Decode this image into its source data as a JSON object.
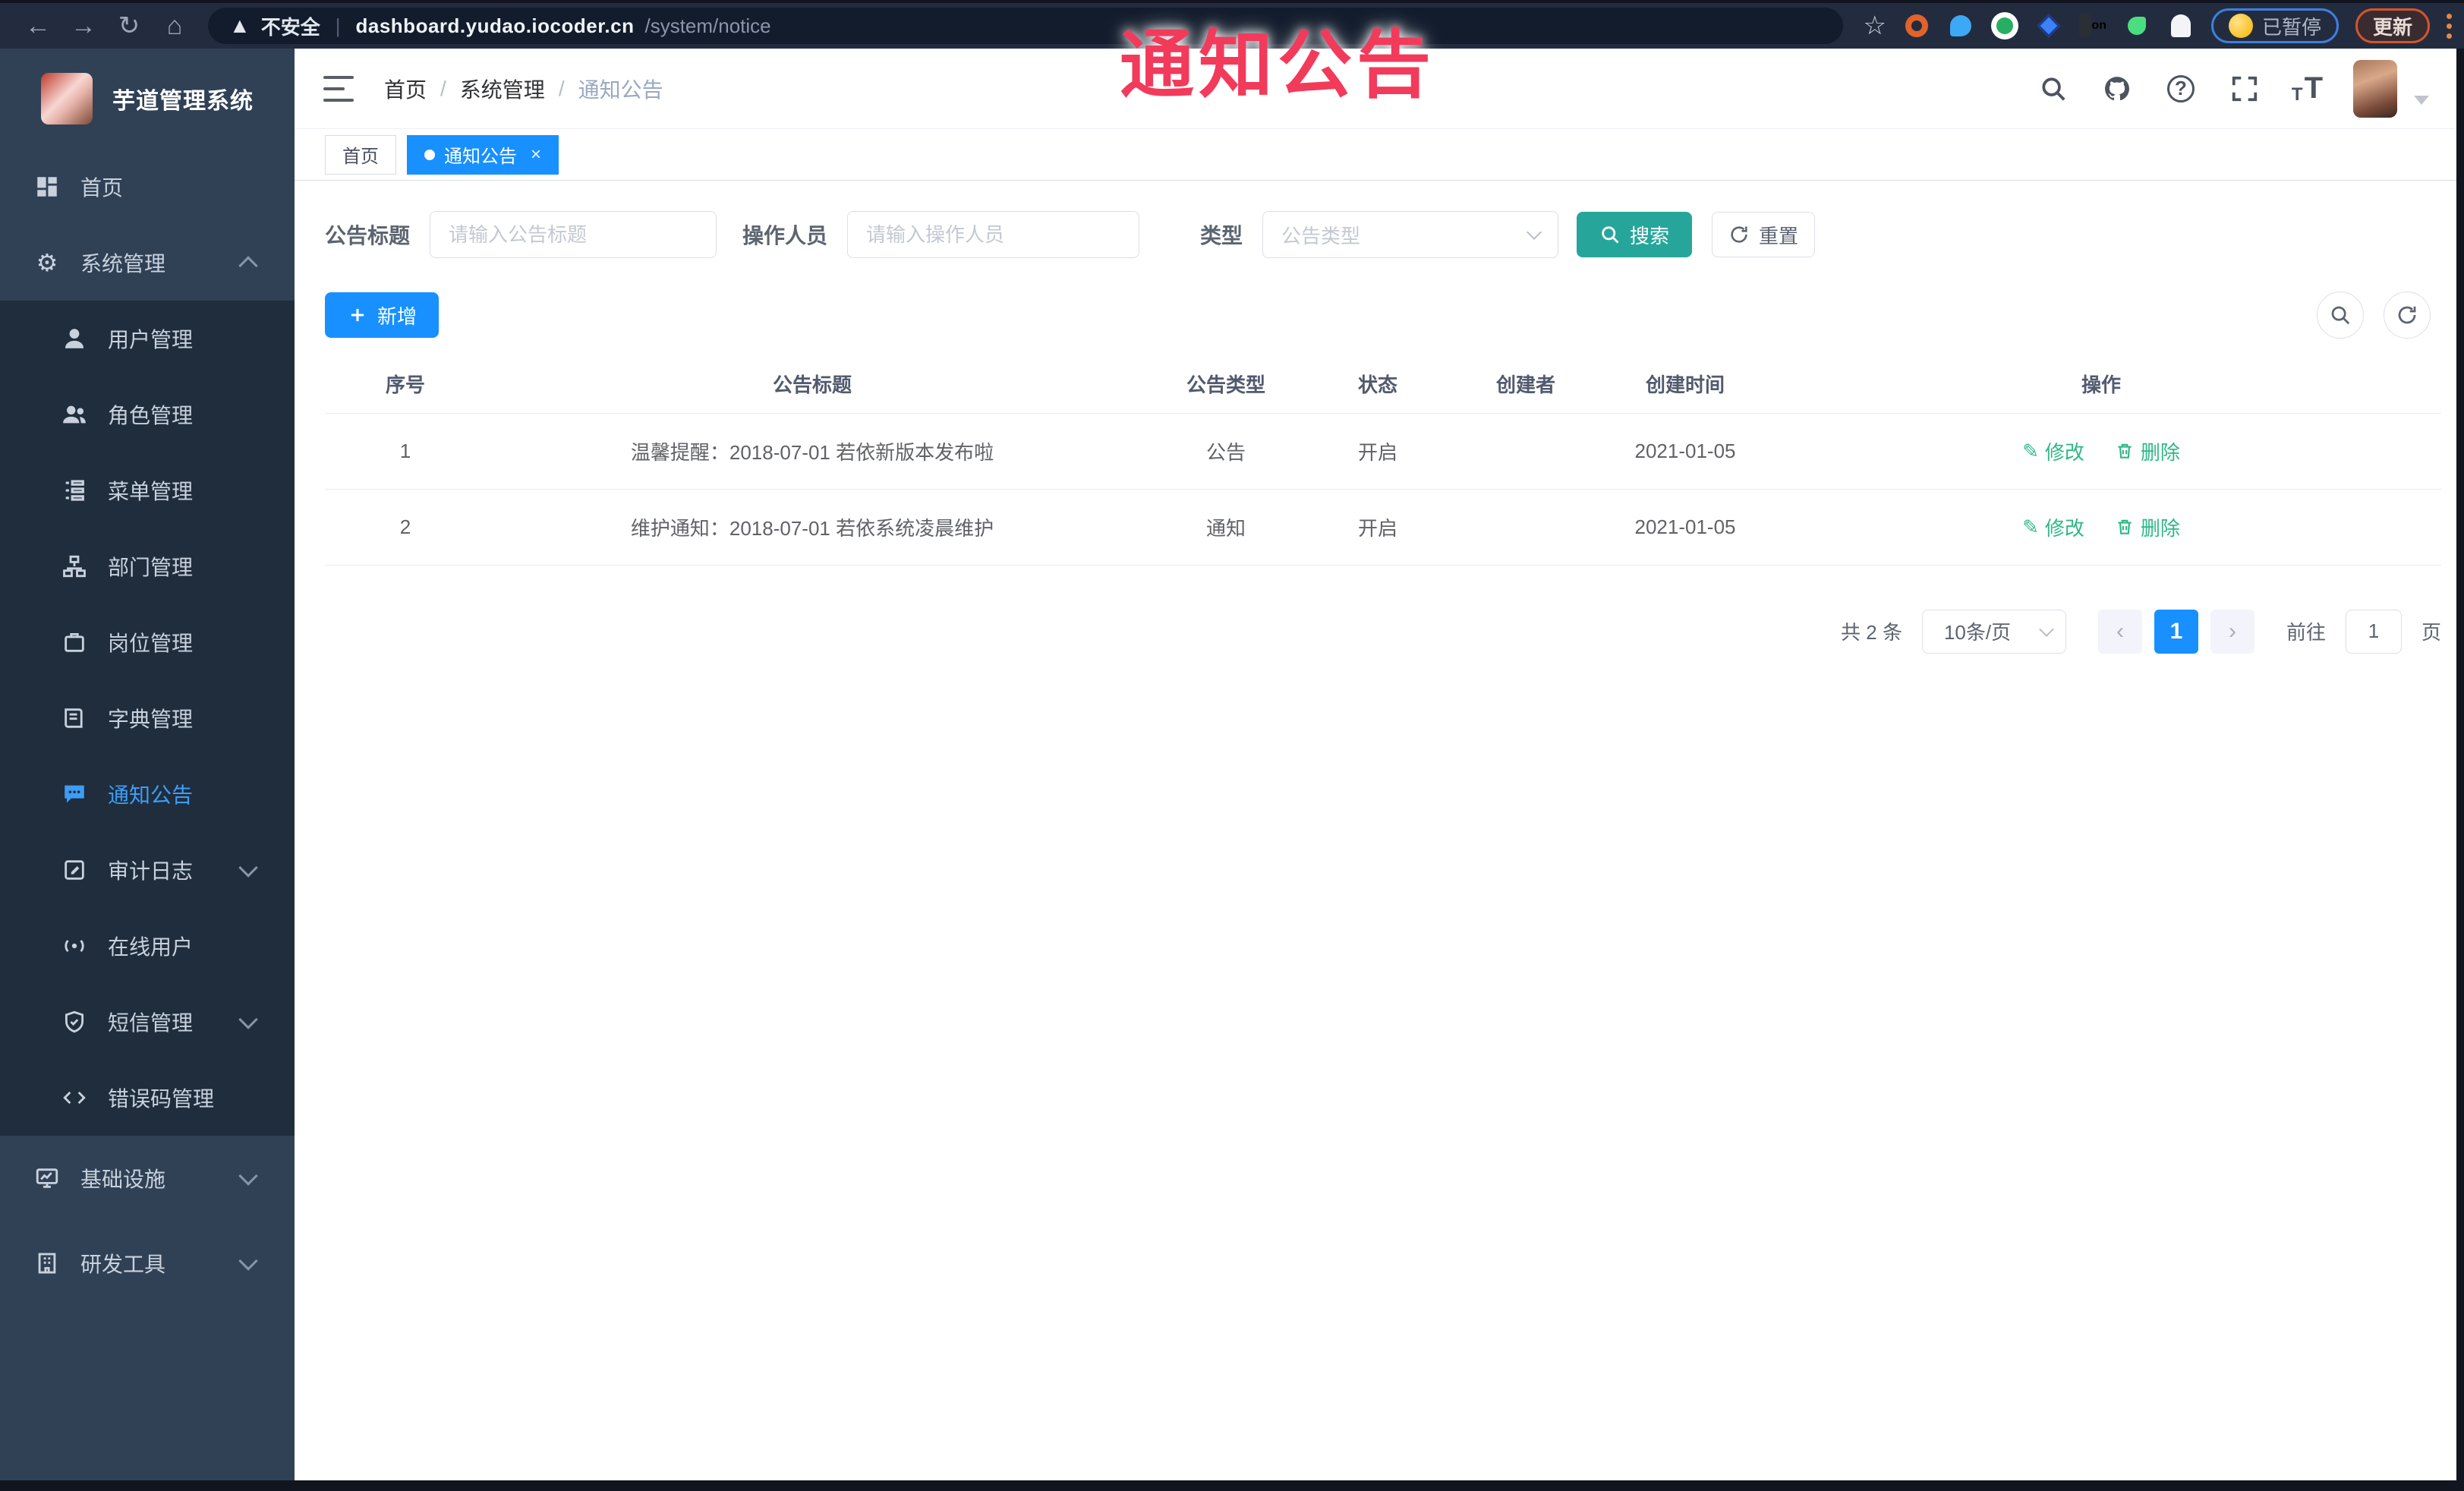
{
  "browser": {
    "security_label": "不安全",
    "url_host": "dashboard.yudao.iocoder.cn",
    "url_path": "/system/notice",
    "paused_label": "已暂停",
    "update_label": "更新"
  },
  "overlay": {
    "title": "通知公告"
  },
  "colors": {
    "accent_blue": "#1890ff",
    "search_teal": "#26a69a",
    "action_green": "#2eb885",
    "overlay_red": "#f23a5b",
    "sidebar_bg": "#304156",
    "submenu_bg": "#1f2d3d",
    "active_menu": "#3d9df5"
  },
  "sidebar": {
    "logo_title": "芋道管理系统",
    "items": [
      {
        "label": "首页"
      },
      {
        "label": "系统管理"
      },
      {
        "label": "用户管理"
      },
      {
        "label": "角色管理"
      },
      {
        "label": "菜单管理"
      },
      {
        "label": "部门管理"
      },
      {
        "label": "岗位管理"
      },
      {
        "label": "字典管理"
      },
      {
        "label": "通知公告"
      },
      {
        "label": "审计日志"
      },
      {
        "label": "在线用户"
      },
      {
        "label": "短信管理"
      },
      {
        "label": "错误码管理"
      },
      {
        "label": "基础设施"
      },
      {
        "label": "研发工具"
      }
    ]
  },
  "breadcrumb": [
    "首页",
    "系统管理",
    "通知公告"
  ],
  "tabs": [
    {
      "label": "首页"
    },
    {
      "label": "通知公告",
      "close": "×"
    }
  ],
  "filters": {
    "title_label": "公告标题",
    "title_placeholder": "请输入公告标题",
    "operator_label": "操作人员",
    "operator_placeholder": "请输入操作人员",
    "type_label": "类型",
    "type_placeholder": "公告类型",
    "search_label": "搜索",
    "reset_label": "重置"
  },
  "toolbar": {
    "add_label": "新增"
  },
  "table": {
    "headers": [
      "序号",
      "公告标题",
      "公告类型",
      "状态",
      "创建者",
      "创建时间",
      "操作"
    ],
    "rows": [
      {
        "no": "1",
        "title": "温馨提醒：2018-07-01 若依新版本发布啦",
        "type": "公告",
        "status": "开启",
        "creator": "",
        "created": "2021-01-05"
      },
      {
        "no": "2",
        "title": "维护通知：2018-07-01 若依系统凌晨维护",
        "type": "通知",
        "status": "开启",
        "creator": "",
        "created": "2021-01-05"
      }
    ],
    "edit_label": "修改",
    "delete_label": "删除"
  },
  "pagination": {
    "total": "共 2 条",
    "page_size": "10条/页",
    "prev": "‹",
    "current": "1",
    "next": "›",
    "goto_label": "前往",
    "goto_value": "1",
    "page_unit": "页"
  }
}
